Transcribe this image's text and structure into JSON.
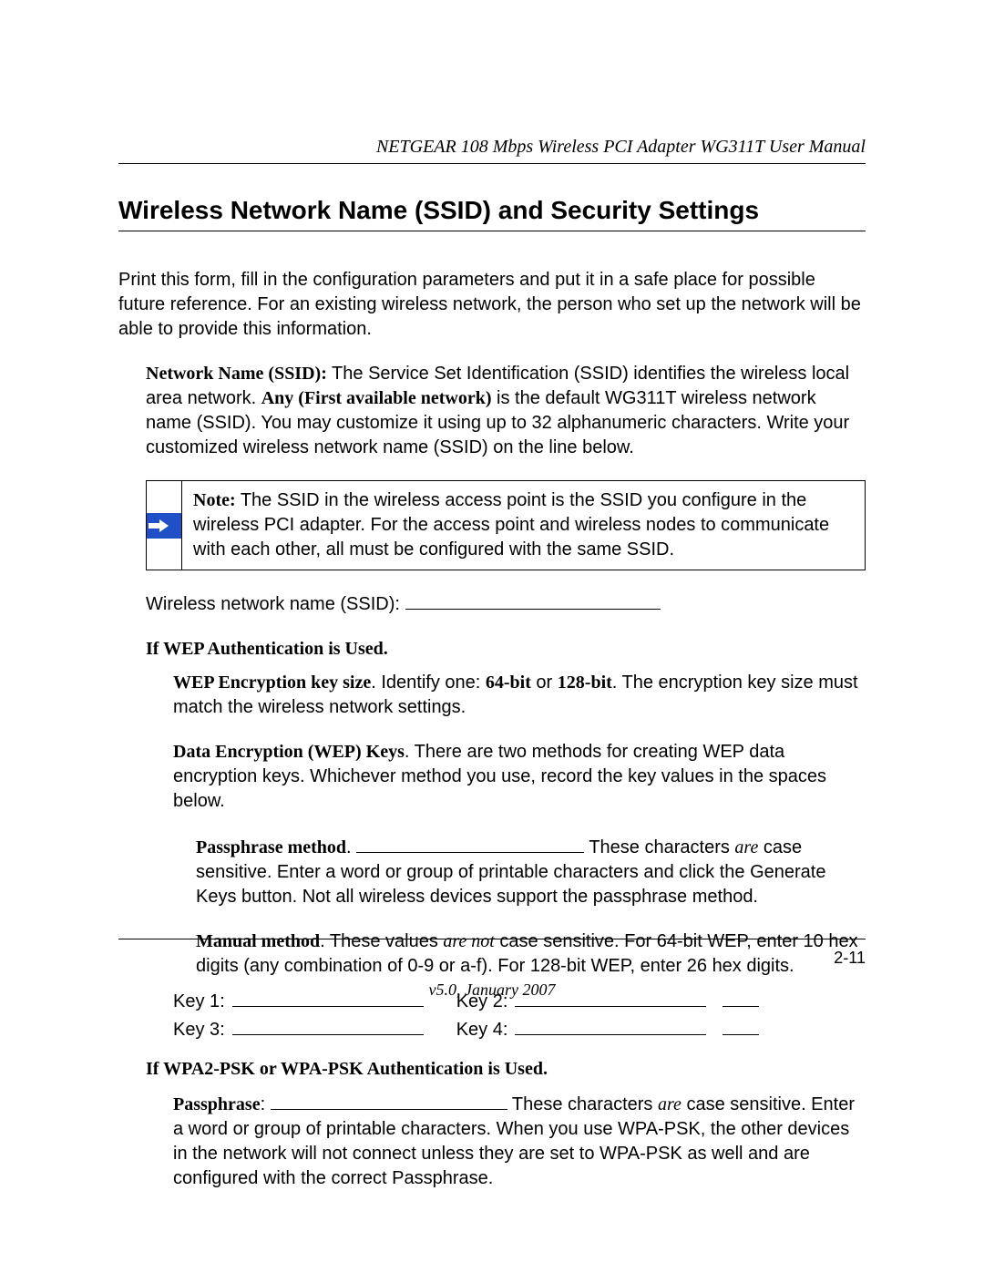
{
  "header": "NETGEAR 108 Mbps Wireless PCI Adapter WG311T User Manual",
  "title": "Wireless Network Name (SSID) and Security Settings",
  "intro": "Print this form, fill in the configuration parameters and put it in a safe place for possible future reference. For an existing wireless network, the person who set up the network will be able to provide this information.",
  "ssid": {
    "label": "Network Name (SSID):",
    "text_a": " The Service Set Identification (SSID) identifies the wireless local area network. ",
    "default_name": "Any (First available network)",
    "text_b": " is the default WG311T wireless network name (SSID). You may customize it using up to 32 alphanumeric characters. Write your customized wireless network name (SSID) on the line below."
  },
  "note": {
    "label": "Note:",
    "text": " The SSID in the wireless access point is the SSID you configure in the wireless PCI adapter. For the access point and wireless nodes to communicate with each other, all must be configured with the same SSID."
  },
  "ssid_line_label": "Wireless network name (SSID): ",
  "wep": {
    "heading": "If WEP Authentication is Used.",
    "keysize_label": "WEP Encryption key size",
    "keysize_a": ". Identify one: ",
    "kb64": "64-bit",
    "or": " or ",
    "kb128": "128-bit",
    "keysize_b": ". The encryption key size must match the wireless network settings.",
    "data_label": "Data Encryption (WEP) Keys",
    "data_text": ". There are two methods for creating WEP data encryption keys. Whichever method you use, record the key values in the spaces below.",
    "pass_label": "Passphrase method",
    "pass_a": ". ",
    "pass_b": " These characters ",
    "pass_are": "are",
    "pass_c": " case sensitive. Enter a word or group of printable characters and click the Generate Keys button. Not all wireless devices support the passphrase method.",
    "manual_label": "Manual method",
    "manual_a": ". These values ",
    "manual_not": "are not",
    "manual_b": " case sensitive. For 64-bit WEP, enter 10 hex digits (any combination of 0-9 or a-f). For 128-bit WEP, enter 26 hex digits.",
    "key1": "Key 1:",
    "key2": "Key 2:",
    "key3": "Key 3:",
    "key4": "Key 4:"
  },
  "wpa": {
    "heading": "If WPA2-PSK or WPA-PSK Authentication is Used.",
    "pass_label": "Passphrase",
    "a": ": ",
    "b": " These characters ",
    "are": "are",
    "c": " case sensitive. Enter a word or group of printable characters. When you use WPA-PSK, the other devices in the network will not connect unless they are set to WPA-PSK as well and are configured with the correct Passphrase."
  },
  "footer": {
    "page": "2-11",
    "version": "v5.0, January 2007"
  }
}
